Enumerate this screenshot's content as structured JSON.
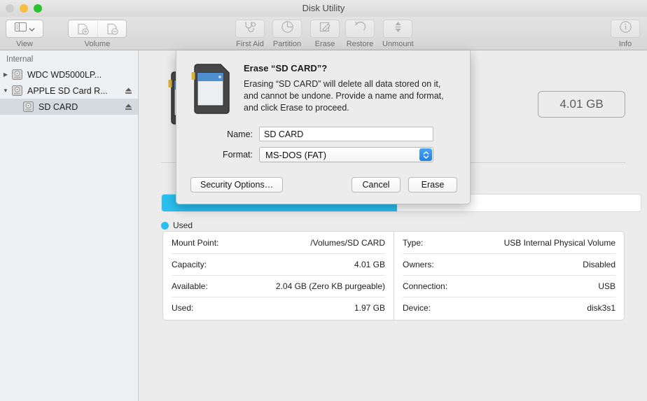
{
  "window": {
    "title": "Disk Utility",
    "traffic_lights": [
      "close-button",
      "minimize-button",
      "zoom-button"
    ]
  },
  "toolbar": {
    "items": [
      {
        "name": "view",
        "label": "View",
        "icon": "sidebar-icon",
        "type": "menu-button"
      },
      {
        "name": "volume",
        "label": "Volume",
        "icon": "volume-add-remove-icon",
        "type": "segmented"
      },
      {
        "name": "first-aid",
        "label": "First Aid",
        "icon": "stethoscope-icon",
        "type": "button"
      },
      {
        "name": "partition",
        "label": "Partition",
        "icon": "pie-chart-icon",
        "type": "button"
      },
      {
        "name": "erase",
        "label": "Erase",
        "icon": "erase-icon",
        "type": "button"
      },
      {
        "name": "restore",
        "label": "Restore",
        "icon": "undo-arrow-icon",
        "type": "button"
      },
      {
        "name": "unmount",
        "label": "Unmount",
        "icon": "eject-arrows-icon",
        "type": "button"
      },
      {
        "name": "info",
        "label": "Info",
        "icon": "info-circle-icon",
        "type": "button"
      }
    ]
  },
  "sidebar": {
    "section_header": "Internal",
    "items": [
      {
        "label": "WDC WD5000LP...",
        "indent": 0,
        "expanded": false,
        "twisty": "▶",
        "selected": false,
        "eject": false
      },
      {
        "label": "APPLE SD Card R...",
        "indent": 0,
        "expanded": true,
        "twisty": "▼",
        "selected": false,
        "eject": true
      },
      {
        "label": "SD CARD",
        "indent": 1,
        "expanded": null,
        "twisty": "",
        "selected": true,
        "eject": true
      }
    ]
  },
  "main": {
    "capacity_badge": "4.01 GB",
    "capacity_bar": {
      "used_percent": 49.1,
      "color": "#29c0f0"
    },
    "legend": [
      {
        "label": "Used",
        "color": "#29c0f0"
      }
    ],
    "info_left": [
      {
        "label": "Mount Point:",
        "value": "/Volumes/SD CARD"
      },
      {
        "label": "Capacity:",
        "value": "4.01 GB"
      },
      {
        "label": "Available:",
        "value": "2.04 GB (Zero KB purgeable)"
      },
      {
        "label": "Used:",
        "value": "1.97 GB"
      }
    ],
    "info_right": [
      {
        "label": "Type:",
        "value": "USB Internal Physical Volume"
      },
      {
        "label": "Owners:",
        "value": "Disabled"
      },
      {
        "label": "Connection:",
        "value": "USB"
      },
      {
        "label": "Device:",
        "value": "disk3s1"
      }
    ]
  },
  "sheet": {
    "icon": "sd-card-icon",
    "title": "Erase “SD CARD”?",
    "body": "Erasing “SD CARD” will delete all data stored on it, and cannot be undone. Provide a name and format, and click Erase to proceed.",
    "fields": {
      "name_label": "Name:",
      "name_value": "SD CARD",
      "format_label": "Format:",
      "format_value": "MS-DOS (FAT)"
    },
    "buttons": {
      "security_options": "Security Options…",
      "cancel": "Cancel",
      "erase": "Erase"
    }
  },
  "colors": {
    "accent_cyan": "#29c0f0",
    "stepper_blue": "#2d8fef",
    "selection": "#d3dae0"
  }
}
